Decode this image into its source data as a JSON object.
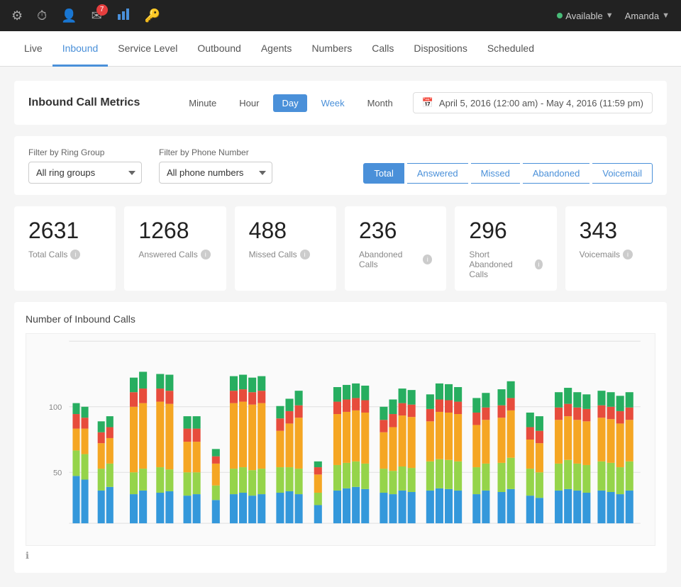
{
  "topbar": {
    "icons": [
      {
        "name": "settings-icon",
        "symbol": "⚙",
        "active": false
      },
      {
        "name": "clock-icon",
        "symbol": "⏱",
        "active": false
      },
      {
        "name": "user-icon",
        "symbol": "👤",
        "active": false
      },
      {
        "name": "mail-icon",
        "symbol": "✉",
        "active": false,
        "badge": "7"
      },
      {
        "name": "chart-icon",
        "symbol": "📊",
        "active": true
      },
      {
        "name": "key-icon",
        "symbol": "🔑",
        "active": false
      }
    ],
    "status": "Available",
    "user": "Amanda"
  },
  "tabs": [
    {
      "label": "Live",
      "active": false
    },
    {
      "label": "Inbound",
      "active": true
    },
    {
      "label": "Service Level",
      "active": false
    },
    {
      "label": "Outbound",
      "active": false
    },
    {
      "label": "Agents",
      "active": false
    },
    {
      "label": "Numbers",
      "active": false
    },
    {
      "label": "Calls",
      "active": false
    },
    {
      "label": "Dispositions",
      "active": false
    },
    {
      "label": "Scheduled",
      "active": false
    }
  ],
  "metrics": {
    "title": "Inbound Call Metrics",
    "time_buttons": [
      {
        "label": "Minute",
        "active": false
      },
      {
        "label": "Hour",
        "active": false
      },
      {
        "label": "Day",
        "active": true
      },
      {
        "label": "Week",
        "active": false
      },
      {
        "label": "Month",
        "active": false
      }
    ],
    "date_range": "April 5, 2016 (12:00 am) - May 4, 2016 (11:59 pm)"
  },
  "filters": {
    "ring_group_label": "Filter by Ring Group",
    "ring_group_value": "All ring groups",
    "phone_number_label": "Filter by Phone Number",
    "phone_number_value": "All phone numbers"
  },
  "view_toggle": [
    {
      "label": "Total",
      "active": true
    },
    {
      "label": "Answered",
      "active": false
    },
    {
      "label": "Missed",
      "active": false
    },
    {
      "label": "Abandoned",
      "active": false
    },
    {
      "label": "Voicemail",
      "active": false
    }
  ],
  "stats": [
    {
      "number": "2631",
      "label": "Total Calls"
    },
    {
      "number": "1268",
      "label": "Answered Calls"
    },
    {
      "number": "488",
      "label": "Missed Calls"
    },
    {
      "number": "236",
      "label": "Abandoned Calls"
    },
    {
      "number": "296",
      "label": "Short Abandoned Calls"
    },
    {
      "number": "343",
      "label": "Voicemails"
    }
  ],
  "chart": {
    "title": "Number of Inbound Calls",
    "y_labels": [
      "100",
      "50"
    ],
    "info_icon": "ℹ"
  },
  "colors": {
    "accent": "#4a90d9",
    "answered": "#f5a623",
    "missed": "#e74c3c",
    "abandoned": "#27ae60",
    "voicemail": "#3498db",
    "short_abandoned": "#95d44a"
  }
}
